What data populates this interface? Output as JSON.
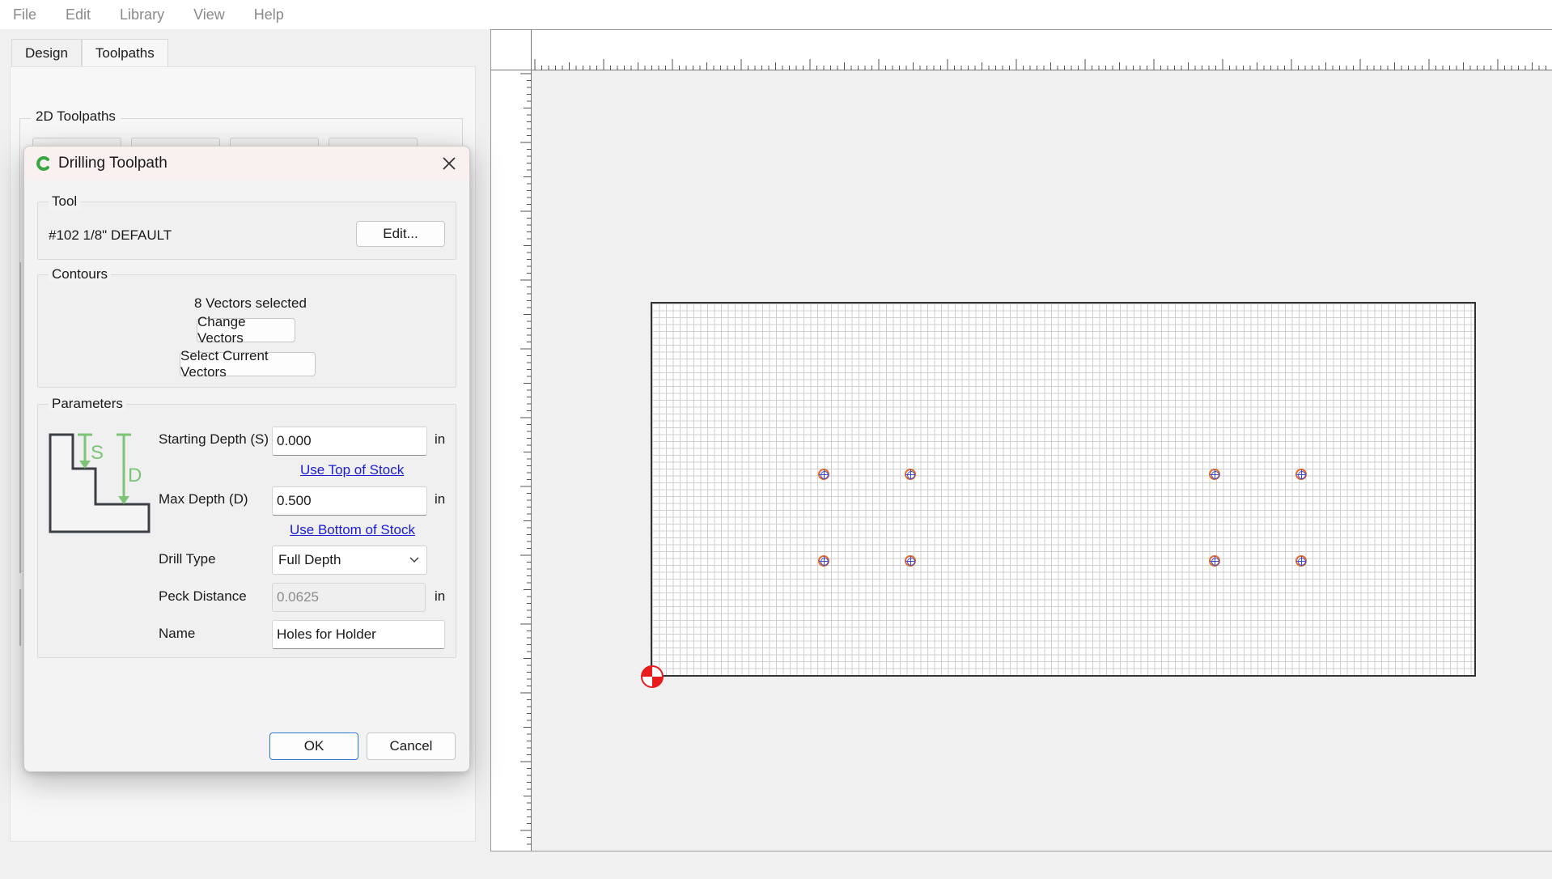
{
  "menu": [
    "File",
    "Edit",
    "Library",
    "View",
    "Help"
  ],
  "left_panel": {
    "tabs": [
      "Design",
      "Toolpaths"
    ],
    "active_tab": "Toolpaths",
    "group_label": "2D Toolpaths"
  },
  "dialog": {
    "title": "Drilling Toolpath",
    "tool": {
      "label": "Tool",
      "name": "#102 1/8\" DEFAULT",
      "edit_button": "Edit..."
    },
    "contours": {
      "label": "Contours",
      "status": "8 Vectors selected",
      "change_button": "Change Vectors",
      "select_button": "Select Current Vectors"
    },
    "parameters": {
      "label": "Parameters",
      "diagram_s": "S",
      "diagram_d": "D",
      "starting_depth_label": "Starting Depth (S)",
      "starting_depth_value": "0.000",
      "use_top_link": "Use Top of Stock",
      "max_depth_label": "Max Depth (D)",
      "max_depth_value": "0.500",
      "use_bottom_link": "Use Bottom of Stock",
      "drill_type_label": "Drill Type",
      "drill_type_value": "Full Depth",
      "peck_label": "Peck Distance",
      "peck_value": "0.0625",
      "name_label": "Name",
      "name_value": "Holes for Holder",
      "unit": "in"
    },
    "ok_button": "OK",
    "cancel_button": "Cancel"
  },
  "colors": {
    "accent": "#2a78d2",
    "link": "#1b1bd6",
    "hole_outer": "#e06b2a",
    "hole_inner": "#3b49d6",
    "origin": "#e81c1c",
    "diagram_green": "#7cc576"
  }
}
